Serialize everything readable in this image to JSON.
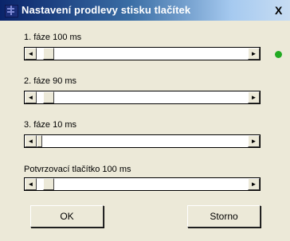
{
  "window": {
    "title": "Nastavení prodlevy stisku tlačítek",
    "close_label": "X"
  },
  "sliders": [
    {
      "label": "1. fáze 100 ms",
      "value_fraction": 0.03
    },
    {
      "label": "2. fáze 90 ms",
      "value_fraction": 0.03
    },
    {
      "label": "3. fáze 10 ms",
      "value_fraction": 0.0
    },
    {
      "label": "Potvrzovací tlačítko 100 ms",
      "value_fraction": 0.03
    }
  ],
  "scroll_arrows": {
    "left": "◄",
    "right": "►"
  },
  "status_indicator": {
    "color": "#22aa22",
    "icon": "status-dot-icon"
  },
  "buttons": {
    "ok_label": "OK",
    "cancel_label": "Storno"
  },
  "colors": {
    "titlebar_start": "#0a246a",
    "titlebar_end": "#c7dcf2",
    "dialog_bg": "#ece9d8"
  }
}
